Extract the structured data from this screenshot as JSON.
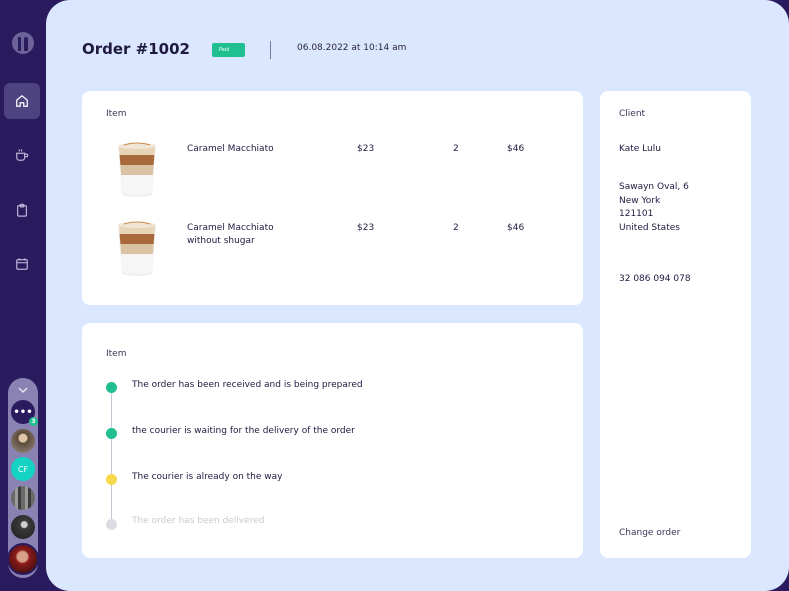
{
  "order": {
    "title": "Order #1002",
    "status": "Paid",
    "datetime": "06.08.2022 at 10:14 am"
  },
  "items_card": {
    "label": "Item",
    "rows": [
      {
        "name_lines": [
          "Caramel Macchiato"
        ],
        "price": "$23",
        "qty": "2",
        "total": "$46"
      },
      {
        "name_lines": [
          "Caramel Macchiato",
          "without shugar"
        ],
        "price": "$23",
        "qty": "2",
        "total": "$46"
      }
    ]
  },
  "status_card": {
    "label": "Item",
    "steps": [
      {
        "text": "The order has been received and is being prepared",
        "color": "#1fbf8f"
      },
      {
        "text": "the courier is waiting for the delivery of the order",
        "color": "#1fbf8f"
      },
      {
        "text": "The courier is already on the way",
        "color": "#f6d84a"
      },
      {
        "text": "The order has been delivered",
        "color": "#dcdce3"
      }
    ]
  },
  "client_card": {
    "label": "Client",
    "name": "Kate Lulu",
    "address_lines": [
      "Sawayn Oval, 6",
      "New York",
      "121101",
      "United States"
    ],
    "phone": "32 086 094 078",
    "change_order": "Change order"
  },
  "sidebar": {
    "nav": [
      {
        "icon": "home-icon"
      },
      {
        "icon": "coffee-cup-icon"
      },
      {
        "icon": "clipboard-icon"
      },
      {
        "icon": "calendar-icon"
      }
    ],
    "users": {
      "more_badge": "3",
      "cf_initials": "CF"
    }
  },
  "colors": {
    "sidebar": "#2a1a5e",
    "background": "#dbe6ff",
    "accent_green": "#1fbf8f",
    "accent_yellow": "#f6d84a"
  }
}
